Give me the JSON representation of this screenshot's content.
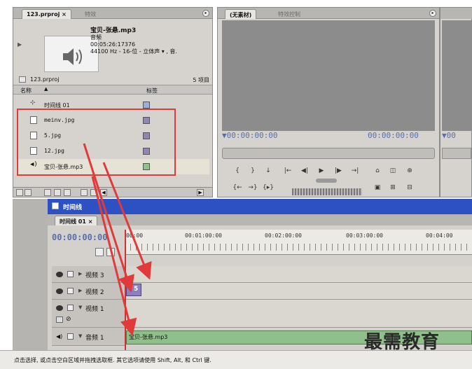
{
  "project_panel": {
    "tabs": [
      {
        "label": "123.prproj ×"
      },
      {
        "label": "特效"
      }
    ],
    "clip": {
      "name": "宝贝-张悬.mp3",
      "type": "音频",
      "duration": "00:05:26:17376",
      "format": "44100 Hz - 16-位 - 立体声 ▾ , 音."
    },
    "project_name": "123.prproj",
    "item_count": "5 项目",
    "col_name": "名称",
    "col_label": "标签",
    "items": [
      {
        "name": "时间线 01"
      },
      {
        "name": "meinv.jpg"
      },
      {
        "name": "5.jpg"
      },
      {
        "name": "12.jpg"
      },
      {
        "name": "宝贝-张悬.mp3"
      }
    ]
  },
  "monitor": {
    "tabs": [
      {
        "label": "(无素材)"
      },
      {
        "label": "特效控制"
      }
    ],
    "timecode_in": "▼00:00:00:00",
    "timecode_out": "00:00:00:00",
    "right_timecode": "▼00",
    "controls_row1": [
      "{",
      "}",
      "↓",
      "|←",
      "◀|",
      "▶",
      "|▶",
      "→|",
      "⌂",
      "◫",
      "⊕"
    ],
    "controls_row2": [
      "{←",
      "→}",
      "{▸}",
      "",
      "",
      "▣",
      "⊞",
      "⊟"
    ]
  },
  "timeline": {
    "title": "时间线",
    "tab": "时间线 01 ×",
    "timecode": "00:00:00:00",
    "ruler_labels": [
      "00:00",
      "00:01:00:00",
      "00:02:00:00",
      "00:03:00:00",
      "00:04:00"
    ],
    "tracks": [
      {
        "name": "视频 3"
      },
      {
        "name": "视频 2"
      },
      {
        "name": "视频 1"
      },
      {
        "name": "音频 1"
      }
    ],
    "clip_video2_label": "5",
    "clip_audio1_label": "宝贝-张悬.mp3"
  },
  "status_bar": {
    "text": "点击选择, 或点击空白区域并拖拽选取框. 其它选项请使用 Shift, Alt, 和 Ctrl 键."
  },
  "watermark": "最需教育",
  "colors": {
    "highlight": "#e03a3a",
    "timeline_title": "#2d50c2",
    "image_label": "#8f86b5",
    "audio_label": "#8fc28c",
    "timecode": "#5a6da8"
  }
}
